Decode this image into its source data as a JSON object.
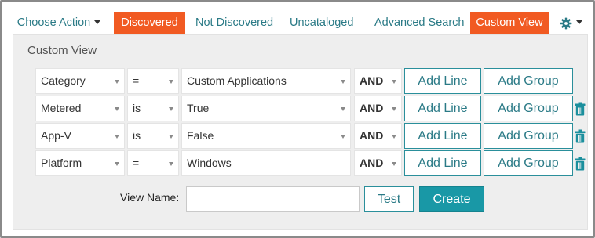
{
  "tabs": {
    "choose_action": "Choose Action",
    "discovered": "Discovered",
    "not_discovered": "Not Discovered",
    "uncataloged": "Uncataloged",
    "advanced_search": "Advanced Search",
    "custom_view": "Custom View"
  },
  "settings_icon": "gear-icon",
  "panel": {
    "title": "Custom View",
    "rows": [
      {
        "field": "Category",
        "operator": "=",
        "value": "Custom Applications",
        "value_is_select": true,
        "logic": "AND",
        "add_line": "Add Line",
        "add_group": "Add Group",
        "deletable": false
      },
      {
        "field": "Metered",
        "operator": "is",
        "value": "True",
        "value_is_select": true,
        "logic": "AND",
        "add_line": "Add Line",
        "add_group": "Add Group",
        "deletable": true
      },
      {
        "field": "App-V",
        "operator": "is",
        "value": "False",
        "value_is_select": true,
        "logic": "AND",
        "add_line": "Add Line",
        "add_group": "Add Group",
        "deletable": true
      },
      {
        "field": "Platform",
        "operator": "=",
        "value": "Windows",
        "value_is_select": false,
        "logic": "AND",
        "add_line": "Add Line",
        "add_group": "Add Group",
        "deletable": true
      }
    ],
    "view_name_label": "View Name:",
    "view_name_value": "",
    "test_label": "Test",
    "create_label": "Create"
  },
  "colors": {
    "active_tab": "#f15a22",
    "link": "#2a7a86",
    "primary_button": "#1998a6",
    "trash_icon": "#1b8f9d"
  }
}
